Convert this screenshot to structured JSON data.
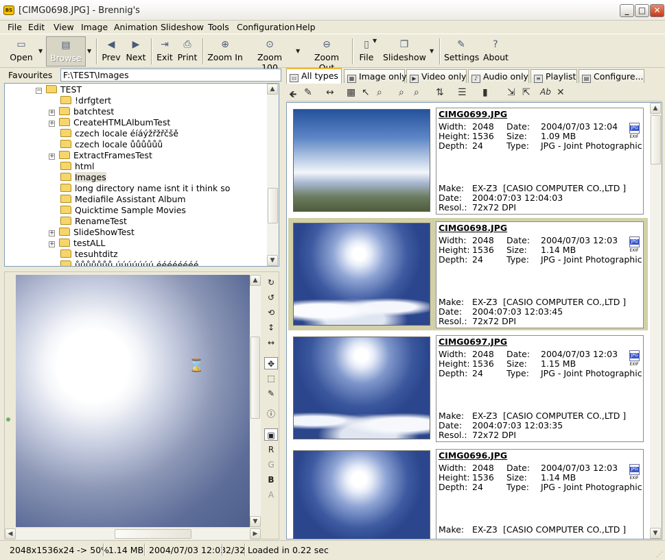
{
  "window": {
    "title": "[CIMG0698.JPG] - Brennig's",
    "app_icon": "BS"
  },
  "menu": [
    "File",
    "Edit",
    "View",
    "Image",
    "Animation",
    "Slideshow",
    "Tools",
    "Configuration",
    "Help"
  ],
  "toolbar": {
    "open": "Open",
    "browse": "Browse",
    "prev": "Prev",
    "next": "Next",
    "exit": "Exit",
    "print": "Print",
    "zoom_in": "Zoom In",
    "zoom_100": "Zoom 100",
    "zoom_out": "Zoom Out",
    "file": "File",
    "slideshow": "Slideshow",
    "settings": "Settings",
    "about": "About"
  },
  "favourites": {
    "label": "Favourites",
    "path": "F:\\TEST\\Images"
  },
  "tree": [
    {
      "label": "TEST",
      "expander": "−"
    },
    {
      "label": "!drfgtert",
      "expander": ""
    },
    {
      "label": "batchtest",
      "expander": "+"
    },
    {
      "label": "CreateHTMLAlbumTest",
      "expander": "+"
    },
    {
      "label": "czech locale éíáýžřžřčšě",
      "expander": ""
    },
    {
      "label": "czech locale ůůůůůů",
      "expander": ""
    },
    {
      "label": "ExtractFramesTest",
      "expander": "+"
    },
    {
      "label": "html",
      "expander": ""
    },
    {
      "label": "Images",
      "expander": "",
      "selected": true
    },
    {
      "label": "long directory name isnt it i think so",
      "expander": ""
    },
    {
      "label": "Mediafile Assistant Album",
      "expander": ""
    },
    {
      "label": "Quicktime Sample Movies",
      "expander": ""
    },
    {
      "label": "RenameTest",
      "expander": ""
    },
    {
      "label": "SlideShowTest",
      "expander": "+"
    },
    {
      "label": "testALL",
      "expander": "+"
    },
    {
      "label": "tesuhtditz",
      "expander": ""
    },
    {
      "label": "ůůůůůůů úúúúúúú éééééééé",
      "expander": ""
    }
  ],
  "preview_tools": [
    "rotate-cw",
    "rotate-ccw",
    "rotate-180",
    "flip-vertical",
    "flip-horizontal",
    "move",
    "select",
    "pencil",
    "info",
    "color-channels"
  ],
  "channels": [
    "R",
    "G",
    "B",
    "A"
  ],
  "tabs": [
    "All types",
    "Image only",
    "Video only",
    "Audio only",
    "Playlist",
    "Configure..."
  ],
  "file_labels": {
    "width": "Width:",
    "height": "Height:",
    "depth": "Depth:",
    "date": "Date:",
    "size": "Size:",
    "type": "Type:",
    "make": "Make:",
    "resol": "Resol.:",
    "badge": "JPG",
    "exif": "EXIF"
  },
  "files": [
    {
      "name": "CIMG0699.JPG",
      "width": "2048",
      "height": "1536",
      "depth": "24",
      "date": "2004/07/03 12:04",
      "size": "1.09 MB",
      "type": "JPG - Joint Photographic E",
      "make": "EX-Z3",
      "maker": "[CASIO COMPUTER CO.,LTD ]",
      "exif_date": "2004:07:03 12:04:03",
      "resol": "72x72 DPI"
    },
    {
      "name": "CIMG0698.JPG",
      "width": "2048",
      "height": "1536",
      "depth": "24",
      "date": "2004/07/03 12:03",
      "size": "1.14 MB",
      "type": "JPG - Joint Photographic E",
      "make": "EX-Z3",
      "maker": "[CASIO COMPUTER CO.,LTD ]",
      "exif_date": "2004:07:03 12:03:45",
      "resol": "72x72 DPI",
      "selected": true
    },
    {
      "name": "CIMG0697.JPG",
      "width": "2048",
      "height": "1536",
      "depth": "24",
      "date": "2004/07/03 12:03",
      "size": "1.15 MB",
      "type": "JPG - Joint Photographic E",
      "make": "EX-Z3",
      "maker": "[CASIO COMPUTER CO.,LTD ]",
      "exif_date": "2004:07:03 12:03:35",
      "resol": "72x72 DPI"
    },
    {
      "name": "CIMG0696.JPG",
      "width": "2048",
      "height": "1536",
      "depth": "24",
      "date": "2004/07/03 12:03",
      "size": "1.14 MB",
      "type": "JPG - Joint Photographic E",
      "make": "EX-Z3",
      "maker": "[CASIO COMPUTER CO.,LTD ]",
      "exif_date": "",
      "resol": ""
    }
  ],
  "status": {
    "dimensions": "2048x1536x24 -> 50%",
    "filesize": "1.14 MB",
    "date": "2004/07/03 12:03",
    "position": "2/32",
    "loaded": "Loaded in 0.22 sec"
  }
}
